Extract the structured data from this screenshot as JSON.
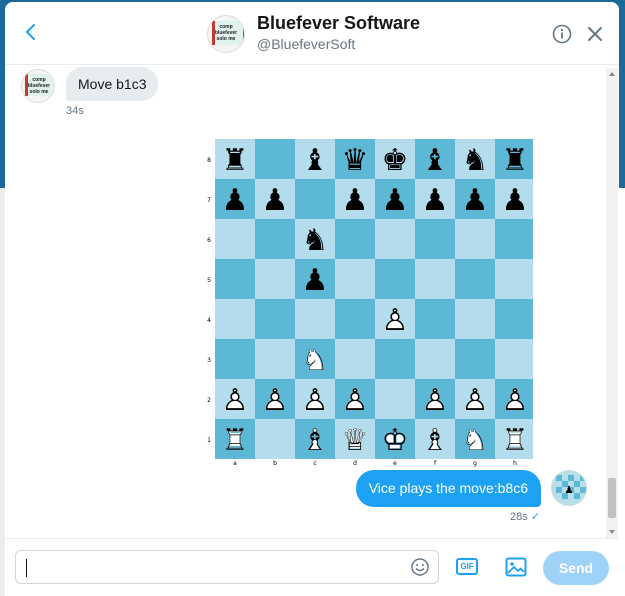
{
  "header": {
    "name": "Bluefever Software",
    "handle": "@BluefeverSoft",
    "avatar_text": "comp bluefever solo me"
  },
  "messages": {
    "incoming": {
      "text": "Move b1c3",
      "time": "34s"
    },
    "outgoing": {
      "text": "Vice plays the move:b8c6",
      "time": "28s",
      "status": "✓"
    }
  },
  "board": {
    "ranks": [
      "8",
      "7",
      "6",
      "5",
      "4",
      "3",
      "2",
      "1"
    ],
    "files": [
      "a",
      "b",
      "c",
      "d",
      "e",
      "f",
      "g",
      "h"
    ],
    "light_color": "#b3dcec",
    "dark_color": "#5cb8d4",
    "position": [
      [
        "r",
        "",
        "b",
        "q",
        "k",
        "b",
        "n",
        "r"
      ],
      [
        "p",
        "p",
        "",
        "p",
        "p",
        "p",
        "p",
        "p"
      ],
      [
        "",
        "",
        "n",
        "",
        "",
        "",
        "",
        ""
      ],
      [
        "",
        "",
        "p",
        "",
        "",
        "",
        "",
        ""
      ],
      [
        "",
        "",
        "",
        "",
        "P",
        "",
        "",
        ""
      ],
      [
        "",
        "",
        "N",
        "",
        "",
        "",
        "",
        ""
      ],
      [
        "P",
        "P",
        "P",
        "P",
        "",
        "P",
        "P",
        "P"
      ],
      [
        "R",
        "",
        "B",
        "Q",
        "K",
        "B",
        "N",
        "R"
      ]
    ]
  },
  "composer": {
    "placeholder": "",
    "value": "",
    "gif_label": "GIF",
    "send_label": "Send"
  },
  "colors": {
    "accent": "#1da1f2",
    "send_disabled": "#9ed2f7",
    "incoming_bubble": "#e6ecf0"
  },
  "icons": {
    "back": "back-arrow-icon",
    "info": "info-icon",
    "close": "close-icon",
    "emoji": "emoji-icon",
    "gif": "gif-icon",
    "image": "image-icon"
  }
}
